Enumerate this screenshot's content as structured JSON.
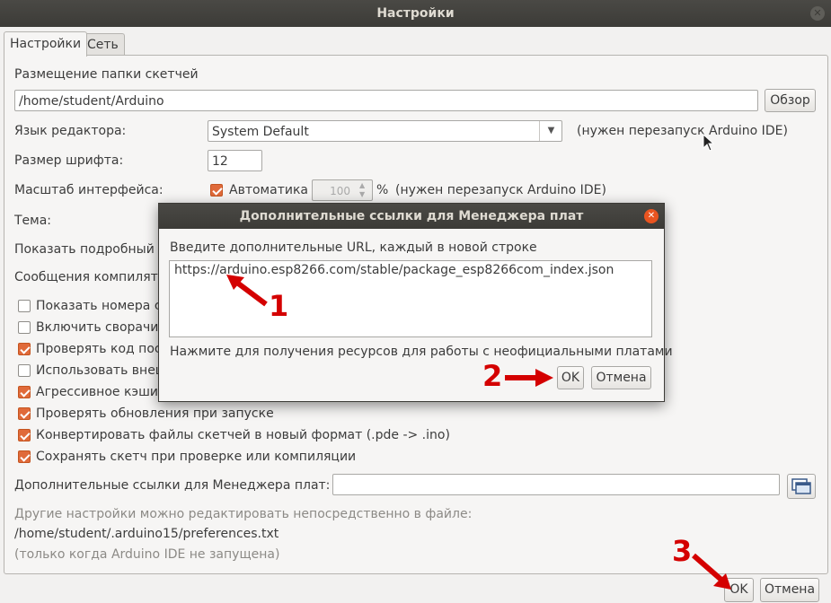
{
  "window": {
    "title": "Настройки"
  },
  "tabs": [
    {
      "label": "Настройки",
      "active": true
    },
    {
      "label": "Сеть",
      "active": false
    }
  ],
  "settings": {
    "sketchbook_label": "Размещение папки скетчей",
    "sketchbook_path": "/home/student/Arduino",
    "browse_button": "Обзор",
    "language_label": "Язык редактора:",
    "language_value": "System Default",
    "language_note": "(нужен перезапуск Arduino IDE)",
    "font_size_label": "Размер шрифта:",
    "font_size_value": "12",
    "scale_label": "Масштаб интерфейса:",
    "scale_auto_label": "Автоматика",
    "scale_value": "100",
    "scale_unit": "%",
    "scale_note": "(нужен перезапуск Arduino IDE)",
    "theme_label": "Тема:",
    "verbose_label": "Показать подробный в",
    "warnings_label": "Сообщения компилято",
    "checkboxes": [
      {
        "label": "Показать номера ст",
        "checked": false
      },
      {
        "label": "Включить сворачи",
        "checked": false
      },
      {
        "label": "Проверять код пос",
        "checked": true
      },
      {
        "label": "Использовать внеш",
        "checked": false
      },
      {
        "label": "Агрессивное кэшир",
        "checked": true
      },
      {
        "label": "Проверять обновления при запуске",
        "checked": true
      },
      {
        "label": "Конвертировать файлы скетчей в новый формат (.pde -> .ino)",
        "checked": true
      },
      {
        "label": "Сохранять скетч при проверке или компиляции",
        "checked": true
      }
    ],
    "boards_url_label": "Дополнительные ссылки для Менеджера плат:",
    "boards_url_value": "",
    "footer_line1": "Другие настройки можно редактировать непосредственно в файле:",
    "footer_line2": "/home/student/.arduino15/preferences.txt",
    "footer_line3": "(только когда Arduino IDE не запущена)"
  },
  "dialog": {
    "title": "Дополнительные ссылки для Менеджера плат",
    "prompt": "Введите дополнительные URL, каждый в новой строке",
    "url": "https://arduino.esp8266.com/stable/package_esp8266com_index.json",
    "link_text": "Нажмите для получения ресурсов для работы с неофициальными платами",
    "ok": "OK",
    "cancel": "Отмена"
  },
  "footer_buttons": {
    "ok": "OK",
    "cancel": "Отмена"
  },
  "annotations": {
    "step1": "1",
    "step2": "2",
    "step3": "3"
  },
  "colors": {
    "accent": "#e06a3a",
    "arrow": "#d40000",
    "titlebar": "#3c3b37",
    "close": "#e95420"
  }
}
